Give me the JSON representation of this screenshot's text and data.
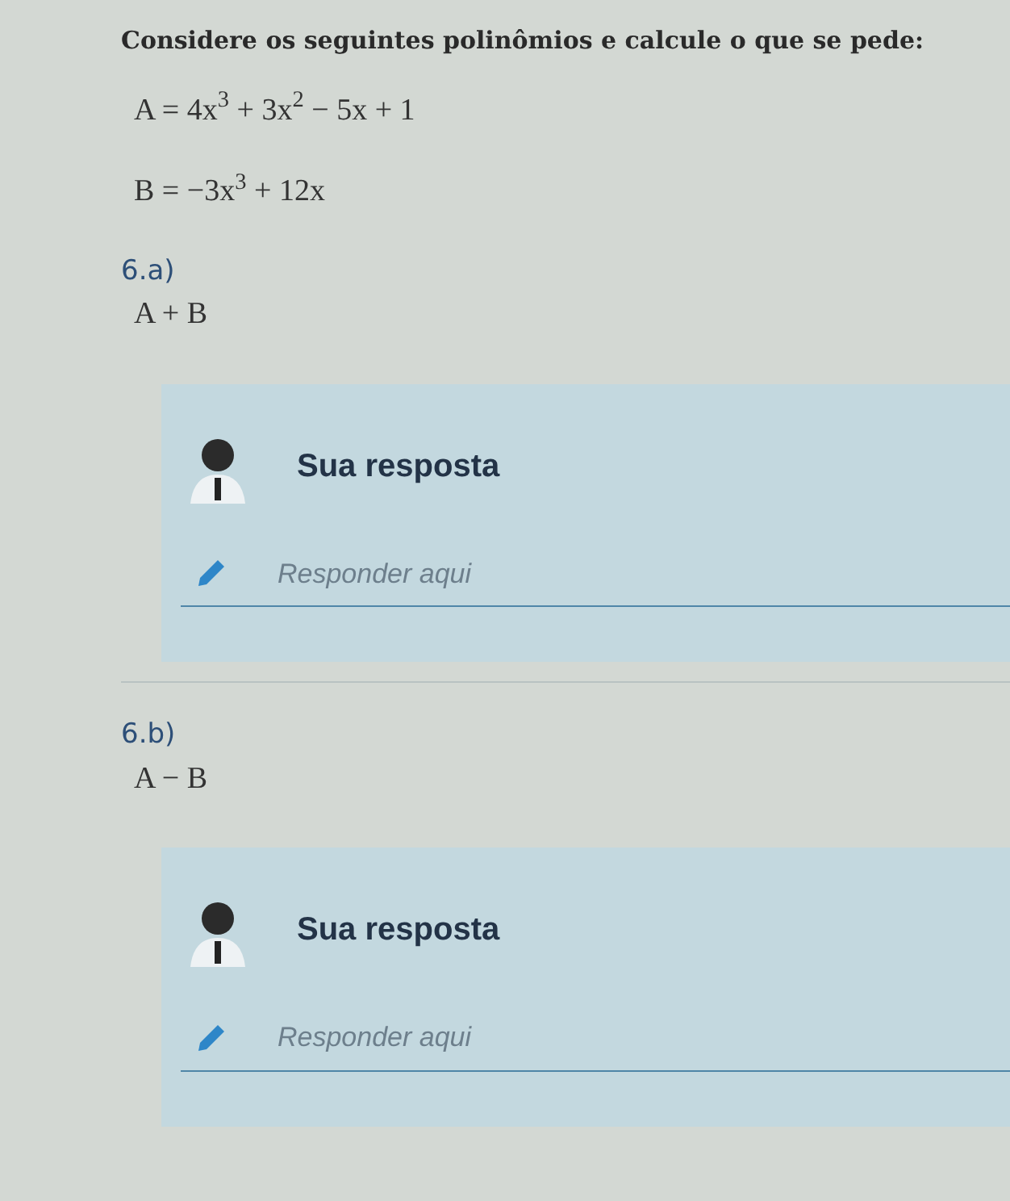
{
  "intro": {
    "heading": "Considere os seguintes polinômios e calcule o que se pede:",
    "formulas": [
      "A = 4x$^{3}$ + 3x$^{2}$ − 5x + 1",
      "B = −3x$^{3}$ + 12x"
    ]
  },
  "questions": [
    {
      "number": "6.a)",
      "expression": "A + B",
      "answer": {
        "title": "Sua resposta",
        "placeholder": "Responder aqui"
      }
    },
    {
      "number": "6.b)",
      "expression": "A − B",
      "answer": {
        "title": "Sua resposta",
        "placeholder": "Responder aqui"
      }
    }
  ]
}
